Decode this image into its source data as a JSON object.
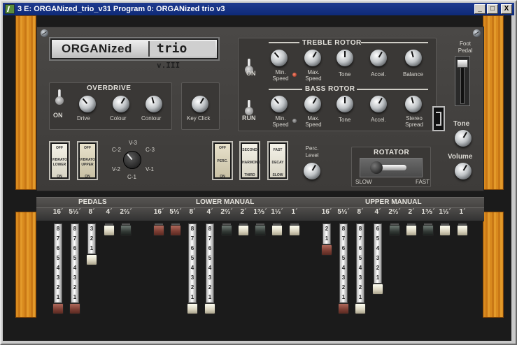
{
  "window": {
    "title": "3 E: ORGANized_trio_v31 Program 0: ORGANized trio v3",
    "min_label": "_",
    "max_label": "□",
    "close_label": "X"
  },
  "logo": {
    "part1": "ORGANized",
    "part2": "trio",
    "version": "v.III"
  },
  "overdrive": {
    "title": "OVERDRIVE",
    "switch_label": "ON",
    "knobs": [
      "Drive",
      "Colour",
      "Contour"
    ]
  },
  "key_click": {
    "label": "Key Click"
  },
  "treble_rotor": {
    "title": "TREBLE ROTOR",
    "switch_label": "ON",
    "knobs": [
      "Min. Speed",
      "Max. Speed",
      "Tone",
      "Accel.",
      "Balance"
    ]
  },
  "bass_rotor": {
    "title": "BASS ROTOR",
    "switch_label": "RUN",
    "knobs": [
      "Min. Speed",
      "Max. Speed",
      "Tone",
      "Accel.",
      "Stereo Spread"
    ]
  },
  "foot_pedal": {
    "label": "Foot Pedal"
  },
  "tone": {
    "label": "Tone"
  },
  "volume": {
    "label": "Volume"
  },
  "vibrato": {
    "lower": {
      "top": "OFF",
      "middle": "VIBRATO LOWER",
      "bottom": "ON"
    },
    "upper": {
      "top": "OFF",
      "middle": "VIBRATO UPPER",
      "bottom": "ON"
    },
    "selector_positions": [
      "V-3",
      "C-3",
      "V-1",
      "C-1",
      "V-2",
      "C-2"
    ]
  },
  "percussion": {
    "perc": {
      "top": "OFF",
      "middle": "PERC.",
      "bottom": "ON"
    },
    "harmonic": {
      "top": "SECOND",
      "middle": "HARMONIC",
      "bottom": "THIRD"
    },
    "decay": {
      "top": "FAST",
      "middle": "DECAY",
      "bottom": "SLOW"
    },
    "level_label": "Perc. Level"
  },
  "rotator": {
    "title": "ROTATOR",
    "slow": "SLOW",
    "fast": "FAST"
  },
  "sections": {
    "pedals": "PEDALS",
    "lower": "LOWER MANUAL",
    "upper": "UPPER MANUAL"
  },
  "footages": {
    "pedals": [
      "16´",
      "5⅓´",
      "8´",
      "4´",
      "2⅔´"
    ],
    "lower": [
      "16´",
      "5⅓´",
      "8´",
      "4´",
      "2⅔´",
      "2´",
      "1⅗´",
      "1⅓´",
      "1´"
    ],
    "upper": [
      "16´",
      "5⅓´",
      "8´",
      "4´",
      "2⅔´",
      "2´",
      "1⅗´",
      "1⅓´",
      "1´"
    ]
  },
  "drawbars": {
    "pedals": [
      8,
      8,
      3,
      0,
      0
    ],
    "lower": [
      0,
      0,
      8,
      8,
      0,
      0,
      0,
      0,
      0
    ],
    "upper": [
      2,
      8,
      8,
      6,
      0,
      0,
      0,
      0,
      0
    ]
  },
  "drawbar_numbers": [
    "1",
    "2",
    "3",
    "4",
    "5",
    "6",
    "7",
    "8"
  ]
}
